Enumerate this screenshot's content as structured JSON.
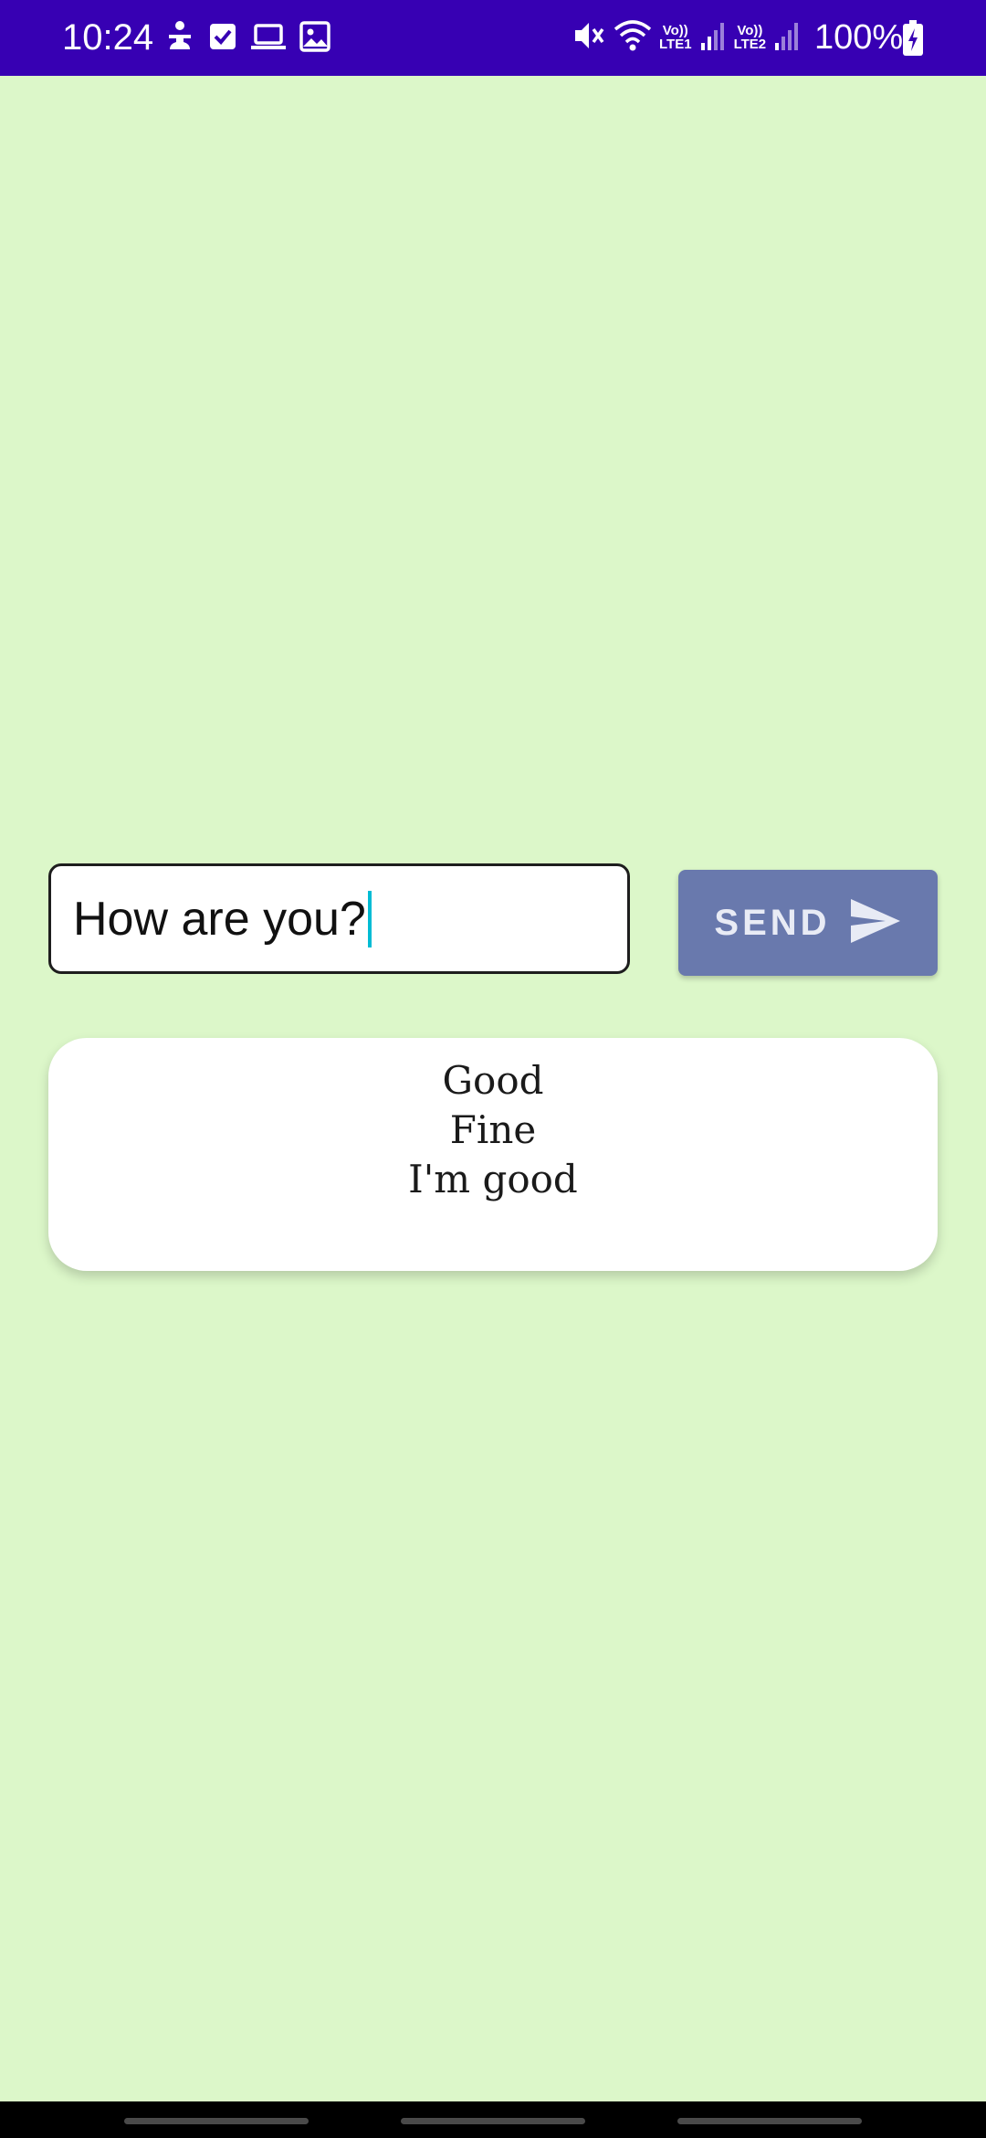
{
  "status_bar": {
    "time": "10:24",
    "battery": "100%",
    "lte1": "LTE1",
    "lte2": "LTE2",
    "volte": "Vo))",
    "background_color": "#3700b3",
    "left_icons": [
      "accessibility-icon",
      "checkbox-icon",
      "laptop-icon",
      "image-icon"
    ],
    "right_icons": [
      "mute-icon",
      "wifi-icon",
      "signal-icon",
      "signal-icon",
      "battery-charging-icon"
    ]
  },
  "compose": {
    "message_value": "How are you?",
    "send_label": "SEND",
    "send_icon": "send-icon",
    "send_color": "#6979ad"
  },
  "suggestions": {
    "items": [
      "Good",
      "Fine",
      "I'm good"
    ]
  },
  "theme": {
    "background": "#dcf7c9",
    "caret_color": "#00bcd4"
  }
}
